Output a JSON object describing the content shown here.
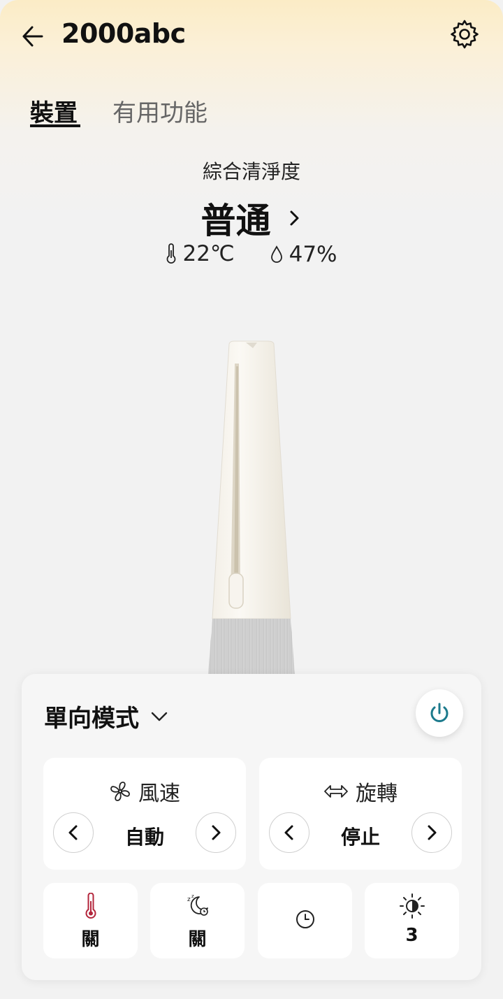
{
  "header": {
    "title": "2000abc",
    "back_icon": "arrow-left-icon",
    "settings_icon": "gear-icon"
  },
  "tabs": [
    {
      "label": "裝置",
      "active": true
    },
    {
      "label": "有用功能",
      "active": false
    }
  ],
  "status": {
    "clean_label": "綜合清淨度",
    "clean_value": "普通",
    "temperature": "22℃",
    "humidity": "47%"
  },
  "controls": {
    "mode": "單向模式",
    "power_icon": "power-icon",
    "wind": {
      "label": "風速",
      "value": "自動",
      "icon": "fan-icon"
    },
    "rotation": {
      "label": "旋轉",
      "value": "停止",
      "icon": "arrows-left-right-icon"
    },
    "quick": [
      {
        "icon": "thermometer-icon",
        "value": "關"
      },
      {
        "icon": "sleep-moon-icon",
        "value": "關"
      },
      {
        "icon": "timer-clock-icon",
        "value": ""
      },
      {
        "icon": "brightness-icon",
        "value": "3"
      }
    ]
  },
  "colors": {
    "accent_teal": "#1c7a8c",
    "thermo_red": "#b3263c",
    "header_gradient_top": "#fbecc6"
  }
}
